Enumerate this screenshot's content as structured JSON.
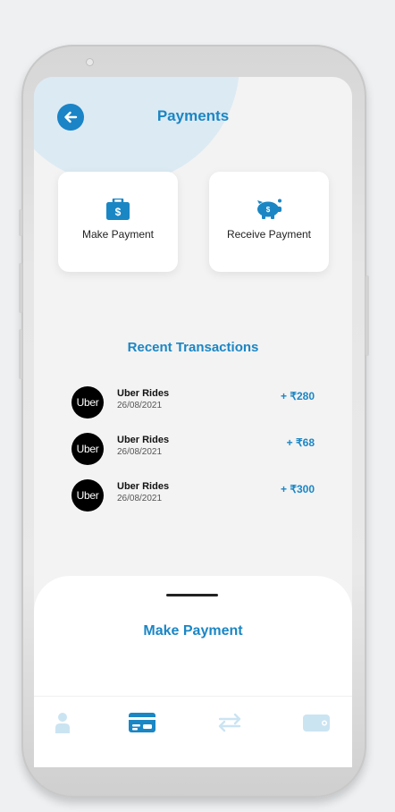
{
  "header": {
    "title": "Payments"
  },
  "actions": [
    {
      "label": "Make Payment",
      "icon": "briefcase-dollar-icon"
    },
    {
      "label": "Receive Payment",
      "icon": "piggy-bank-icon"
    }
  ],
  "recent": {
    "title": "Recent Transactions",
    "items": [
      {
        "logo": "Uber",
        "name": "Uber Rides",
        "date": "26/08/2021",
        "amount": "+ ₹280"
      },
      {
        "logo": "Uber",
        "name": "Uber Rides",
        "date": "26/08/2021",
        "amount": "+ ₹68"
      },
      {
        "logo": "Uber",
        "name": "Uber Rides",
        "date": "26/08/2021",
        "amount": "+ ₹300"
      }
    ]
  },
  "sheet": {
    "title": "Make Payment"
  },
  "nav": [
    {
      "icon": "user-icon",
      "active": false
    },
    {
      "icon": "card-icon",
      "active": true
    },
    {
      "icon": "transfer-icon",
      "active": false
    },
    {
      "icon": "wallet-icon",
      "active": false
    }
  ],
  "colors": {
    "accent": "#1b86c4",
    "inactive": "#cbe4f2"
  }
}
